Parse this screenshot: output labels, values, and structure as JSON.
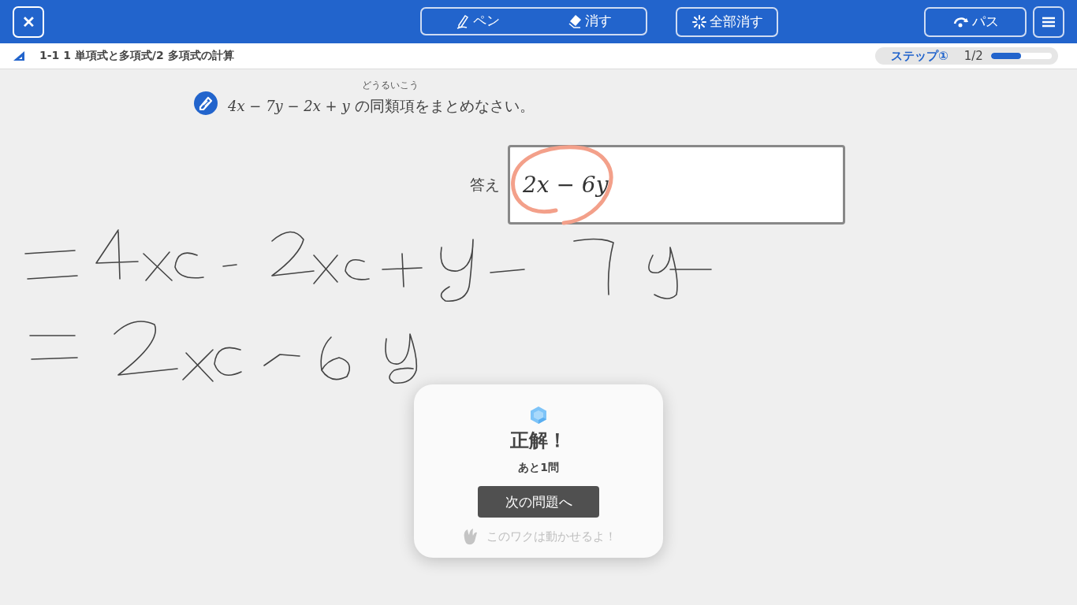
{
  "toolbar": {
    "close_label": "✕",
    "pen": {
      "label": "ペン"
    },
    "erase": {
      "label": "消す"
    },
    "clear_all": "全部消す",
    "pass": "パス"
  },
  "breadcrumb": {
    "text": "1-1 1 単項式と多項式/2 多項式の計算",
    "step": "ステップ①",
    "progress": "1/2",
    "level": 0.5
  },
  "question": {
    "math": "4x − 7y − 2x + y",
    "text": "の同類項をまとめなさい。",
    "furigana": "どうるいこう"
  },
  "answer": {
    "label": "答え",
    "value": "2x − 6y"
  },
  "result": {
    "title": "正解！",
    "remaining": "あと1問",
    "next_button": "次の問題へ",
    "hint": "このワクは動かせるよ！"
  }
}
